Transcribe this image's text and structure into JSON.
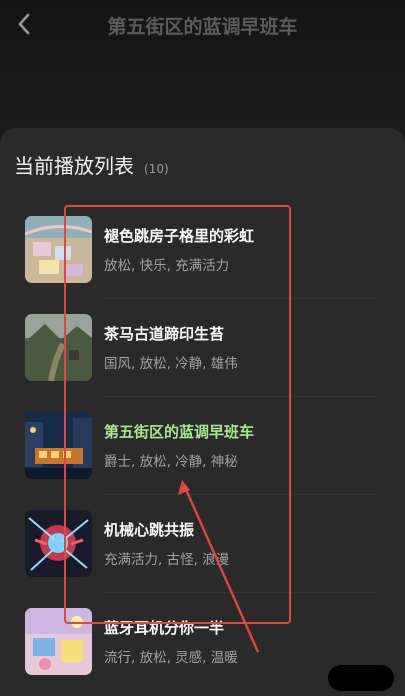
{
  "header": {
    "title": "第五街区的蓝调早班车",
    "back_icon": "chevron-left-icon"
  },
  "playlist": {
    "title": "当前播放列表",
    "count": "(10)",
    "items": [
      {
        "title": "褪色跳房子格里的彩虹",
        "tags": "放松, 快乐, 充满活力",
        "active": false
      },
      {
        "title": "茶马古道蹄印生苔",
        "tags": "国风, 放松, 冷静, 雄伟",
        "active": false
      },
      {
        "title": "第五街区的蓝调早班车",
        "tags": "爵士, 放松, 冷静, 神秘",
        "active": true
      },
      {
        "title": "机械心跳共振",
        "tags": "充满活力, 古怪, 浪漫",
        "active": false
      },
      {
        "title": "蓝牙耳机分你一半",
        "tags": "流行, 放松, 灵感, 温暖",
        "active": false
      }
    ]
  },
  "colors": {
    "active_title": "#a6e88f",
    "annotation": "#e0473f"
  }
}
